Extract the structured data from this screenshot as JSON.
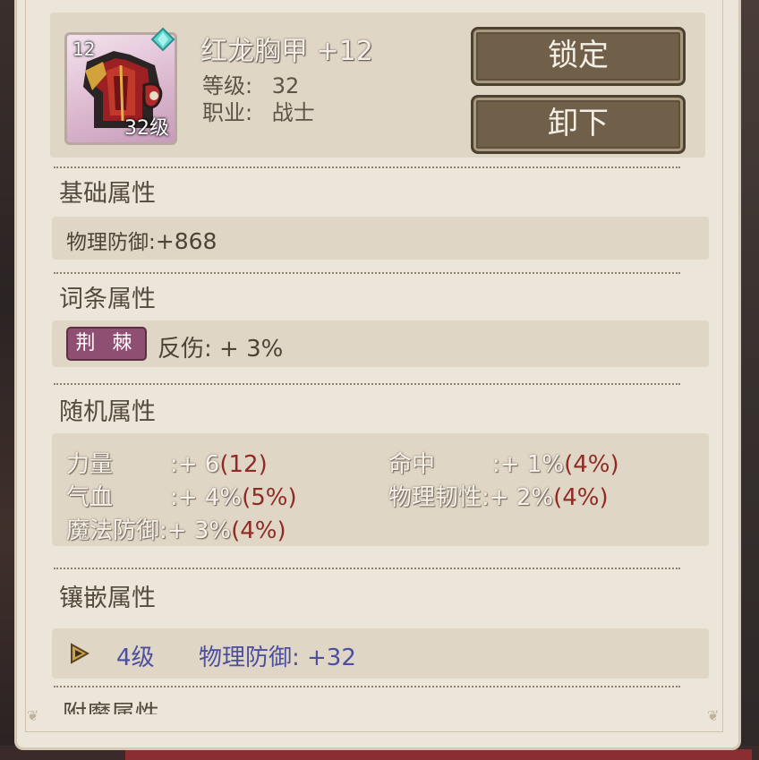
{
  "item": {
    "name": "红龙胸甲 +12",
    "icon_level_top": "12",
    "icon_level_bottom": "32级",
    "level_label": "等级:",
    "level_value": "32",
    "class_label": "职业:",
    "class_value": "战士",
    "icon": "red-dragon-chestplate-icon",
    "gem_icon": "diamond-gem-icon"
  },
  "buttons": {
    "lock": "锁定",
    "unequip": "卸下"
  },
  "sections": {
    "basic": {
      "title": "基础属性",
      "line_label": "物理防御:",
      "line_value": "+868"
    },
    "affix": {
      "title": "词条属性",
      "tag": "荆 棘",
      "line": "反伤: + 3%"
    },
    "random": {
      "title": "随机属性",
      "attrs": [
        {
          "name": "力量",
          "value": ":+ 6",
          "max": "(12)"
        },
        {
          "name": "命中",
          "value": ":+ 1%",
          "max": "(4%)"
        },
        {
          "name": "气血",
          "value": ":+ 4%",
          "max": "(5%)"
        },
        {
          "name": "物理韧性",
          "value": ":+ 2%",
          "max": "(4%)"
        },
        {
          "name": "魔法防御",
          "value": ":+ 3%",
          "max": "(4%)"
        }
      ]
    },
    "inlay": {
      "title": "镶嵌属性",
      "level": "4级",
      "effect": "物理防御: +32",
      "icon": "triangle-gem-icon"
    },
    "enchant": {
      "title": "附魔属性"
    }
  },
  "colors": {
    "panel": "#ece5d9",
    "row_box": "#e0d6c5",
    "button": "#70604a",
    "red_value": "#8f2b25",
    "inlay_text": "#4b4f9f",
    "tag_bg": "#8e4f72"
  }
}
